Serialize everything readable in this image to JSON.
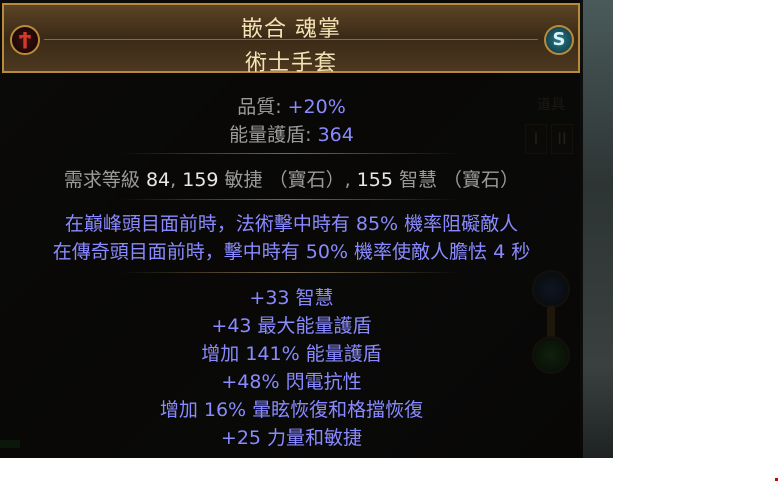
{
  "item": {
    "name": "嵌合 魂掌",
    "base_type": "術士手套",
    "properties": [
      {
        "label": "品質: ",
        "value": "+20%"
      },
      {
        "label": "能量護盾: ",
        "value": "364"
      }
    ],
    "requirements": {
      "prefix": "需求等級 ",
      "level": "84",
      "sep1": ", ",
      "dex": "159",
      "dex_label": " 敏捷 （寶石）",
      "sep2": ", ",
      "int": "155",
      "int_label": " 智慧 （寶石）"
    },
    "implicits": [
      "在巔峰頭目面前時，法術擊中時有 85% 機率阻礙敵人",
      "在傳奇頭目面前時，擊中時有 50% 機率使敵人膽怯 4 秒"
    ],
    "explicits": [
      "+33 智慧",
      "+43 最大能量護盾",
      "增加 141% 能量護盾",
      "+48% 閃電抗性",
      "增加 16% 暈眩恢復和格擋恢復",
      "+25 力量和敏捷"
    ],
    "influences": [
      {
        "name": "hunter-influence-icon",
        "glyph": "Ϯ",
        "color": "#d33a2a"
      },
      {
        "name": "redeemer-influence-icon",
        "glyph": "S",
        "color": "#5ab8c8"
      }
    ]
  },
  "background": {
    "stash_label": "道具",
    "tab_buttons": [
      "I",
      "II"
    ]
  },
  "colors": {
    "rare_name": "#f3e3b5",
    "mod_blue": "#8a8aff",
    "property_gray": "#9a9a9a",
    "frame_gold": "#b98a3a"
  }
}
